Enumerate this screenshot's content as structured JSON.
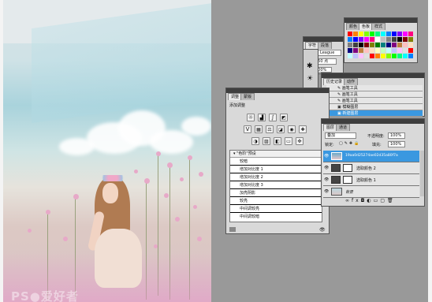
{
  "watermark": "PS&#9679;爱好者",
  "color_panel": {
    "tabs": [
      "颜色",
      "色板",
      "样式"
    ],
    "swatch_colors": [
      "#ff0000",
      "#ff8000",
      "#ffff00",
      "#80ff00",
      "#00ff00",
      "#00ff80",
      "#00ffff",
      "#0080ff",
      "#0000ff",
      "#8000ff",
      "#ff00ff",
      "#ff0080",
      "#ffffff",
      "#c0c0c0",
      "#808080",
      "#404040",
      "#000000",
      "#800000",
      "#808000",
      "#008000",
      "#008080",
      "#000080",
      "#800080",
      "#c08040",
      "#ffc0c0",
      "#ffe0c0",
      "#ffffc0",
      "#c0ffc0",
      "#c0ffff",
      "#c0c0ff",
      "#ffc0ff",
      "#e0e0e0"
    ]
  },
  "char_panel": {
    "tabs": [
      "字符",
      "段落"
    ],
    "font": "Allen League",
    "size": "250 点",
    "pct": "100%"
  },
  "history_panel": {
    "tabs": [
      "历史记录",
      "动作"
    ],
    "items": [
      "画笔工具",
      "画笔工具",
      "画笔工具",
      "模糊图层",
      "新建图层"
    ]
  },
  "adjust_panel": {
    "tabs": [
      "调整",
      "蒙版"
    ],
    "title": "添加调整",
    "presets_header": "\"色阶\"预设",
    "presets": [
      "较暗",
      "增加对比度 1",
      "增加对比度 2",
      "增加对比度 3",
      "加亮阴影",
      "较亮",
      "中间调较亮",
      "中间调较暗"
    ]
  },
  "layers_panel": {
    "tabs": [
      "图层",
      "通道"
    ],
    "blend_mode": "叠加",
    "opacity_label": "不透明度:",
    "opacity": "100%",
    "lock_label": "锁定:",
    "fill_label": "填充:",
    "fill": "100%",
    "layers": [
      {
        "name": "19aa0d25274ae02d35a80f7a",
        "selected": true
      },
      {
        "name": "选取颜色 2",
        "selected": false
      },
      {
        "name": "选取颜色 1",
        "selected": false
      },
      {
        "name": "背景",
        "selected": false
      }
    ]
  }
}
